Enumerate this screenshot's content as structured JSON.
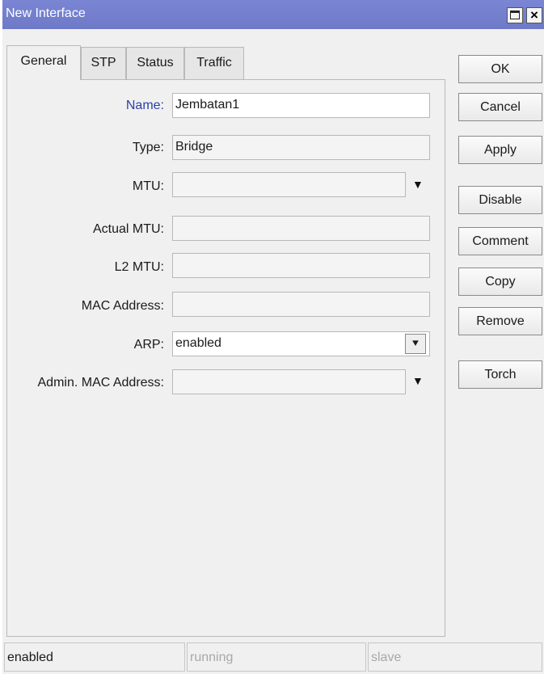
{
  "window": {
    "title": "New Interface"
  },
  "tabs": [
    {
      "label": "General"
    },
    {
      "label": "STP"
    },
    {
      "label": "Status"
    },
    {
      "label": "Traffic"
    }
  ],
  "form": {
    "name": {
      "label": "Name:",
      "value": "Jembatan1"
    },
    "type": {
      "label": "Type:",
      "value": "Bridge"
    },
    "mtu": {
      "label": "MTU:",
      "value": ""
    },
    "actual_mtu": {
      "label": "Actual MTU:",
      "value": ""
    },
    "l2_mtu": {
      "label": "L2 MTU:",
      "value": ""
    },
    "mac": {
      "label": "MAC Address:",
      "value": ""
    },
    "arp": {
      "label": "ARP:",
      "value": "enabled"
    },
    "admin_mac": {
      "label": "Admin. MAC Address:",
      "value": ""
    }
  },
  "buttons": {
    "ok": "OK",
    "cancel": "Cancel",
    "apply": "Apply",
    "disable": "Disable",
    "comment": "Comment",
    "copy": "Copy",
    "remove": "Remove",
    "torch": "Torch"
  },
  "status": {
    "state": "enabled",
    "running": "running",
    "slave": "slave"
  },
  "icons": {
    "maximize": "maximize-icon",
    "close": "close-icon",
    "dropdown": "dropdown-arrow-icon"
  },
  "colors": {
    "titlebar": "#737fcd",
    "name_label": "#2b3fa8"
  }
}
